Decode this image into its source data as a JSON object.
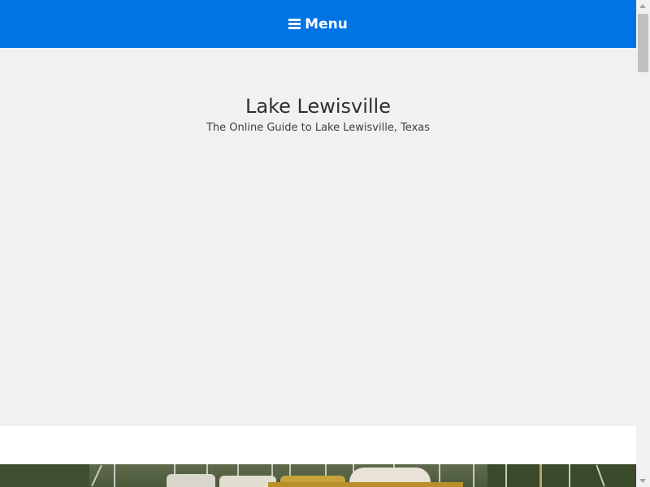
{
  "nav": {
    "menu_label": "Menu",
    "menu_icon": "hamburger-icon",
    "background_color": "#0073e5"
  },
  "header": {
    "site_title": "Lake Lewisville",
    "site_description": "The Online Guide to Lake Lewisville, Texas",
    "background_color": "#f1f1f1"
  },
  "hero": {
    "image_subject": "sailboats-on-lake"
  },
  "scrollbar": {
    "up_icon": "triangle-up-icon",
    "down_icon": "triangle-down-icon"
  }
}
